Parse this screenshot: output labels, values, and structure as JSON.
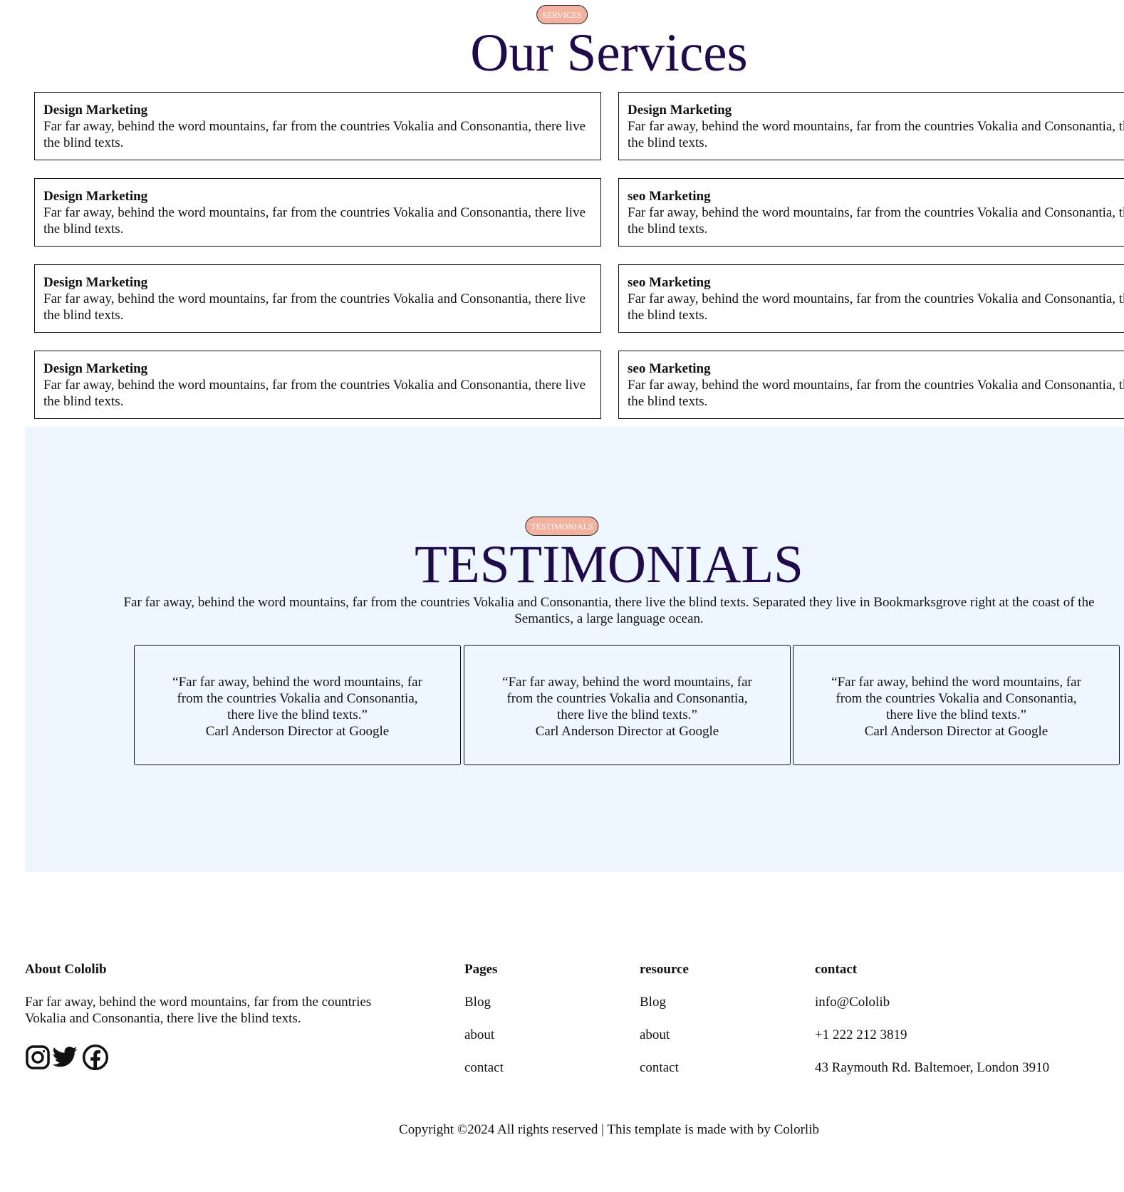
{
  "services": {
    "badge": "SERVICES",
    "title": "Our Services",
    "cards": [
      {
        "title": "Design Marketing",
        "text": "Far far away, behind the word mountains, far from the countries Vokalia and Consonantia, there live the blind texts."
      },
      {
        "title": "Design Marketing",
        "text": "Far far away, behind the word mountains, far from the countries Vokalia and Consonantia, there live the blind texts."
      },
      {
        "title": "Design Marketing",
        "text": "Far far away, behind the word mountains, far from the countries Vokalia and Consonantia, there live the blind texts."
      },
      {
        "title": "seo Marketing",
        "text": "Far far away, behind the word mountains, far from the countries Vokalia and Consonantia, there live the blind texts."
      },
      {
        "title": "Design Marketing",
        "text": "Far far away, behind the word mountains, far from the countries Vokalia and Consonantia, there live the blind texts."
      },
      {
        "title": "seo Marketing",
        "text": "Far far away, behind the word mountains, far from the countries Vokalia and Consonantia, there live the blind texts."
      },
      {
        "title": "Design Marketing",
        "text": "Far far away, behind the word mountains, far from the countries Vokalia and Consonantia, there live the blind texts."
      },
      {
        "title": "seo Marketing",
        "text": "Far far away, behind the word mountains, far from the countries Vokalia and Consonantia, there live the blind texts."
      }
    ]
  },
  "testimonials": {
    "badge": "TESTIMONIALS",
    "title": "TESTIMONIALS",
    "intro": "Far far away, behind the word mountains, far from the countries Vokalia and Consonantia, there live the blind texts. Separated they live in Bookmarksgrove right at the coast of the Semantics, a large language ocean.",
    "items": [
      {
        "quote": "“Far far away, behind the word mountains, far from the countries Vokalia and Consonantia, there live the blind texts.”",
        "author": "Carl Anderson Director at Google"
      },
      {
        "quote": "“Far far away, behind the word mountains, far from the countries Vokalia and Consonantia, there live the blind texts.”",
        "author": "Carl Anderson Director at Google"
      },
      {
        "quote": "“Far far away, behind the word mountains, far from the countries Vokalia and Consonantia, there live the blind texts.”",
        "author": "Carl Anderson Director at Google"
      }
    ]
  },
  "footer": {
    "about": {
      "heading": "About Cololib",
      "text": "Far far away, behind the word mountains, far from the countries Vokalia and Consonantia, there live the blind texts.",
      "social_icons": [
        "instagram-icon",
        "twitter-icon",
        "facebook-icon"
      ]
    },
    "pages": {
      "heading": "Pages",
      "links": [
        "Blog",
        "about",
        "contact"
      ]
    },
    "resource": {
      "heading": "resource",
      "links": [
        "Blog",
        "about",
        "contact"
      ]
    },
    "contact": {
      "heading": "contact",
      "items": [
        "info@Cololib",
        "+1 222 212 3819",
        "43 Raymouth Rd. Baltemoer, London 3910"
      ]
    },
    "copyright": "Copyright ©2024 All rights reserved | This template is made with by Colorlib"
  },
  "colors": {
    "title": "#1f0a4a",
    "badge": "#f3b2a0",
    "testimonials_bg": "#eef7ff"
  }
}
